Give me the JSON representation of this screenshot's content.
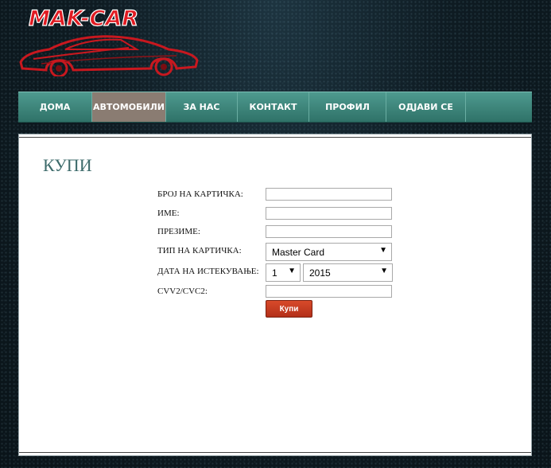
{
  "brand": {
    "logo_text": "MAK-CAR"
  },
  "nav": {
    "items": [
      {
        "label": "ДОМА"
      },
      {
        "label": "АВТОМОБИЛИ"
      },
      {
        "label": "ЗА НАС"
      },
      {
        "label": "КОНТАКТ"
      },
      {
        "label": "ПРОФИЛ"
      },
      {
        "label": "ОДЈАВИ СЕ"
      }
    ],
    "active_index": 1
  },
  "page": {
    "title": "КУПИ"
  },
  "form": {
    "card_number": {
      "label": "БРОЈ НА КАРТИЧКА:",
      "value": ""
    },
    "first_name": {
      "label": "ИМЕ:",
      "value": ""
    },
    "last_name": {
      "label": "ПРЕЗИМЕ:",
      "value": ""
    },
    "card_type": {
      "label": "ТИП НА КАРТИЧКА:",
      "selected": "Master Card"
    },
    "expiry": {
      "label": "ДАТА НА ИСТЕКУВАЊЕ:",
      "month": "1",
      "year": "2015"
    },
    "cvv": {
      "label": "CVV2/CVC2:",
      "value": ""
    },
    "submit_label": "Купи"
  },
  "colors": {
    "nav_teal": "#3f8880",
    "nav_active": "#8a7c72",
    "title_teal": "#3d6b6b",
    "button_red": "#c43d22",
    "logo_red": "#e11b22"
  }
}
